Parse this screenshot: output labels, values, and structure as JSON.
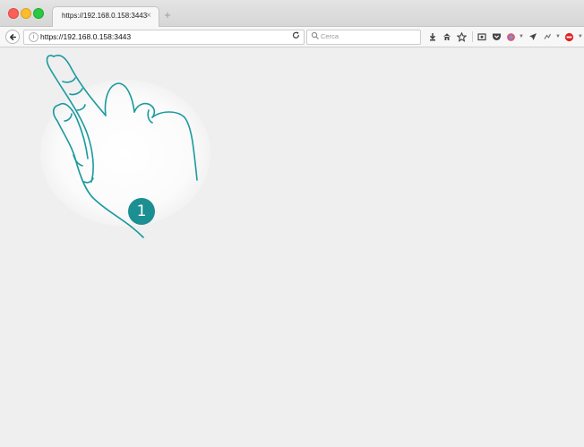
{
  "browser": {
    "tab": {
      "title": "https://192.168.0.158:3443",
      "close_glyph": "×"
    },
    "new_tab_glyph": "+",
    "url": "https://192.168.0.158:3443",
    "search_placeholder": "Cerca",
    "toolbar_icons": [
      "download-icon",
      "home-icon",
      "bookmark-star-icon",
      "screenshot-icon",
      "pocket-icon",
      "extension-icon",
      "send-icon",
      "sync-icon",
      "adblock-icon",
      "menu-icon"
    ]
  },
  "overlay": {
    "step_number": "1",
    "accent_color": "#1b8f91"
  }
}
